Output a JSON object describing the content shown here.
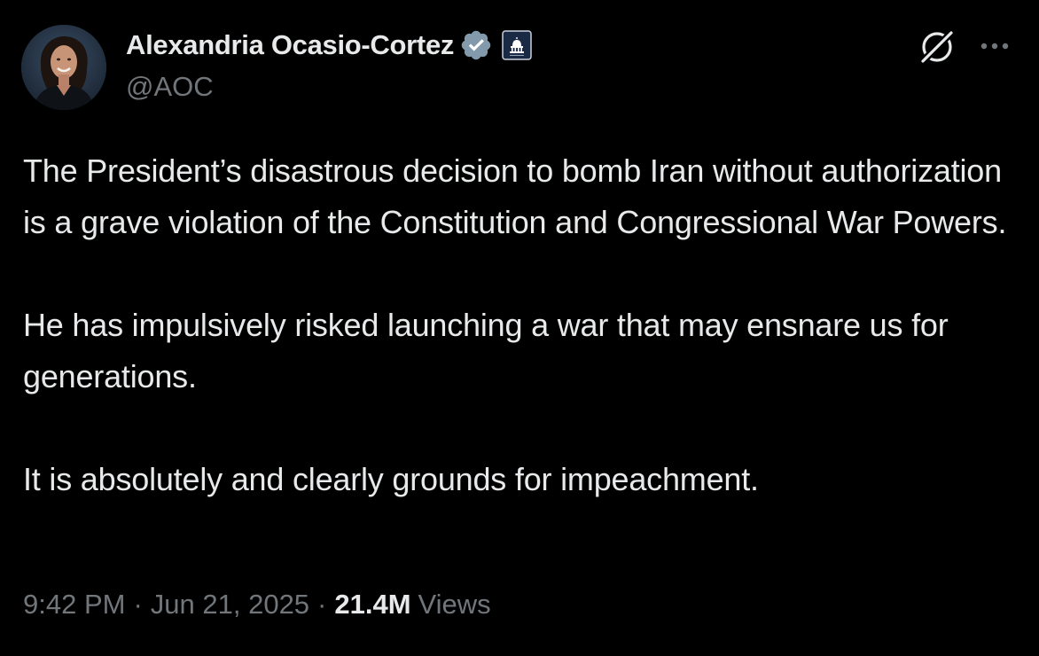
{
  "author": {
    "display_name": "Alexandria Ocasio-Cortez",
    "handle": "@AOC",
    "verified": true,
    "badge_color": "#829aab",
    "affiliation_badge": "capitol-icon"
  },
  "header_actions": {
    "grok_icon": "grok-icon",
    "more_icon": "more-horizontal-icon"
  },
  "tweet": {
    "paragraphs": [
      "The President’s disastrous decision to bomb Iran without authorization is a grave violation of the Constitution and Congressional War Powers.",
      "He has impulsively risked launching a war that may ensnare us for generations.",
      "It is absolutely and clearly grounds for impeachment."
    ]
  },
  "meta": {
    "time": "9:42 PM",
    "separator": "·",
    "date": "Jun 21, 2025",
    "views_count": "21.4M",
    "views_label": "Views"
  },
  "colors": {
    "background": "#000000",
    "primary_text": "#e7e9ea",
    "secondary_text": "#71767b"
  }
}
